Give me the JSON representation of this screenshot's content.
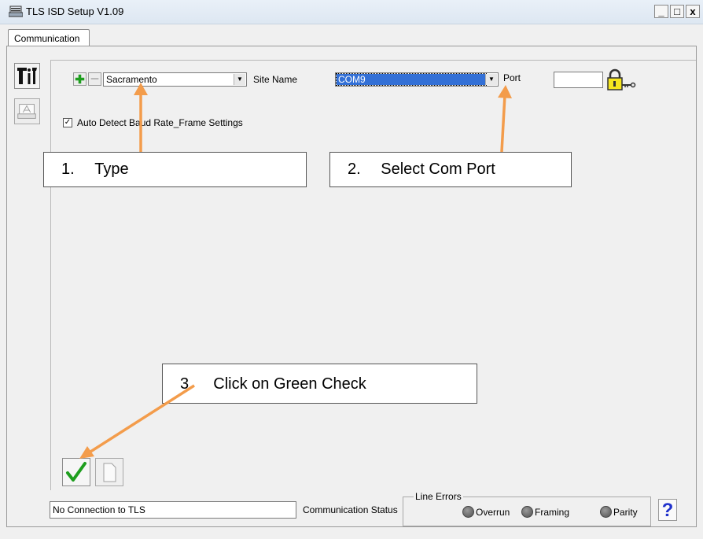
{
  "window": {
    "title": "TLS ISD Setup V1.09",
    "min": "_",
    "max": "□",
    "close": "x"
  },
  "tabs": [
    {
      "label": "Communication"
    }
  ],
  "site": {
    "value": "Sacramento",
    "label": "Site Name"
  },
  "port": {
    "value": "COM9",
    "label": "Port",
    "number": ""
  },
  "auto_detect": {
    "label": "Auto Detect Baud Rate_Frame Settings",
    "checked": true,
    "check_mark": "✓"
  },
  "callouts": [
    {
      "number": "1.",
      "text": "Type"
    },
    {
      "number": "2.",
      "text": "Select Com Port"
    },
    {
      "number": "3.",
      "text": "Click on Green Check"
    }
  ],
  "status": {
    "text": "No Connection to TLS",
    "label": "Communication Status"
  },
  "line_errors": {
    "title": "Line Errors",
    "indicators": [
      "Overrun",
      "Framing",
      "Parity"
    ]
  },
  "help": {
    "label": "?"
  },
  "icons": [
    "window-app-icon",
    "tools-icon",
    "print-icon",
    "add-icon",
    "remove-icon",
    "lock-key-icon",
    "check-icon",
    "blank-page-icon",
    "help-icon"
  ],
  "colors": {
    "accent_green": "#1e9e1e",
    "arrow_orange": "#f39c4b",
    "combo_selected": "#3370d6"
  }
}
